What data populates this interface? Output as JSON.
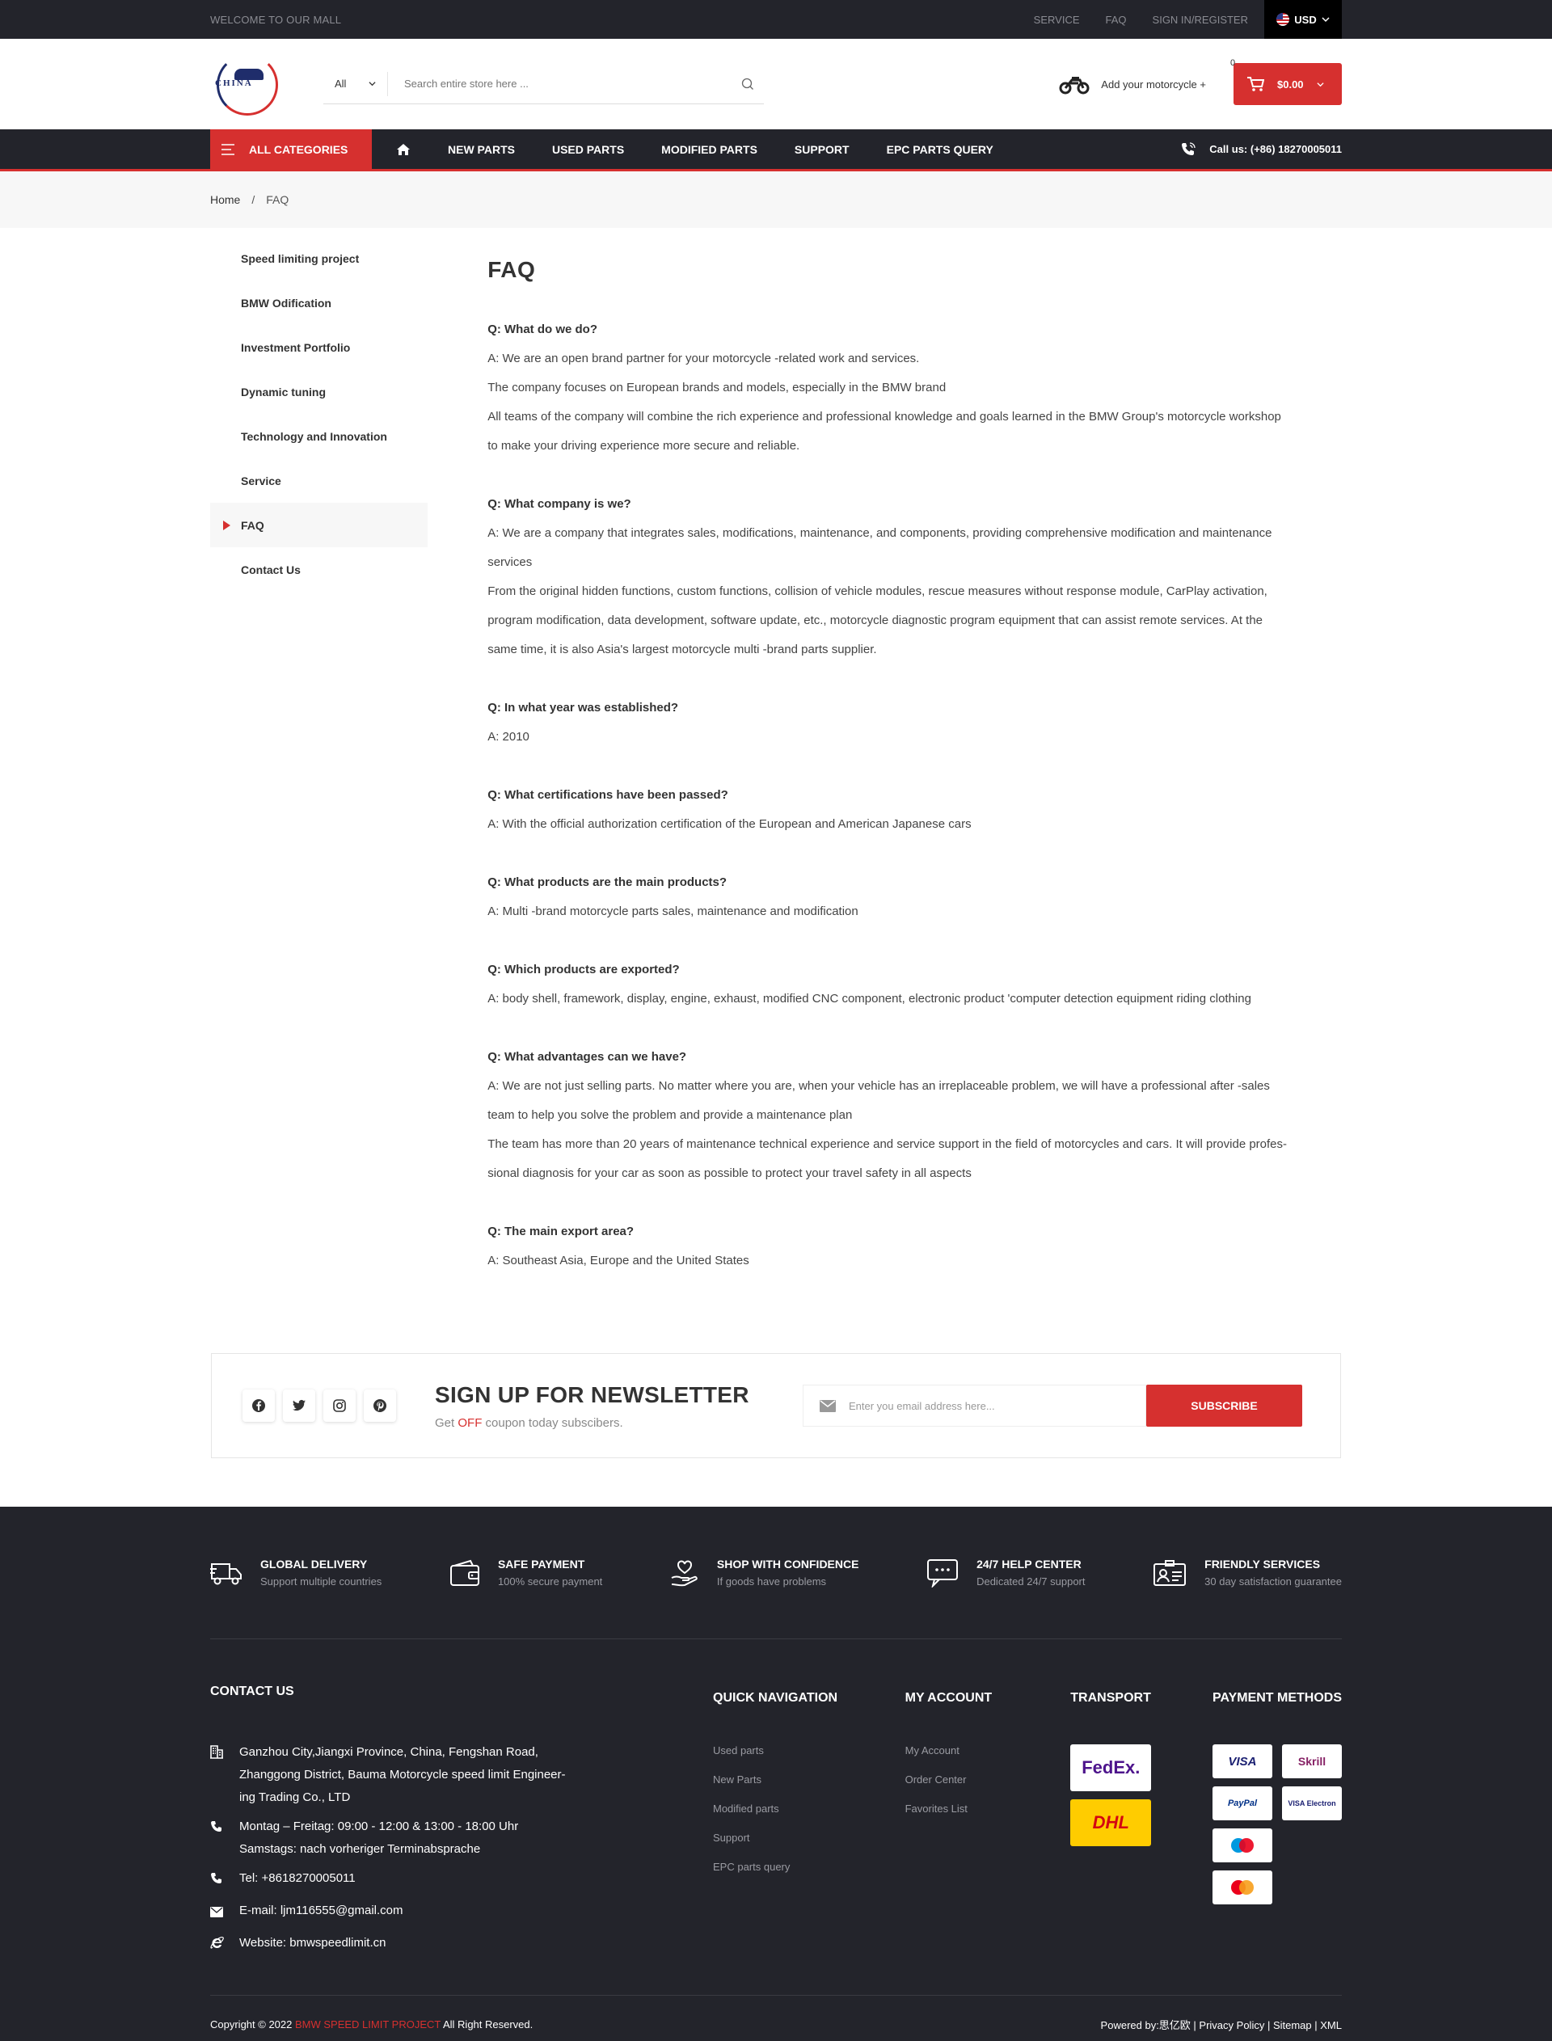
{
  "topbar": {
    "welcome": "WELCOME TO OUR MALL",
    "links": [
      "SERVICE",
      "FAQ",
      "SIGN IN/REGISTER"
    ],
    "currency": "USD"
  },
  "header": {
    "logo_text": "CHINA",
    "search_category": "All",
    "search_placeholder": "Search entire store here ...",
    "motorcycle_label": "Add your motorcycle +",
    "cart_count": "0",
    "cart_total": "$0.00"
  },
  "nav": {
    "all_categories": "ALL CATEGORIES",
    "items": [
      "NEW PARTS",
      "USED PARTS",
      "MODIFIED PARTS",
      "SUPPORT",
      "EPC PARTS QUERY"
    ],
    "call": "Call us: (+86) 18270005011"
  },
  "breadcrumb": {
    "home": "Home",
    "sep": "/",
    "current": "FAQ"
  },
  "sidebar": {
    "items": [
      "Speed limiting project",
      "BMW Odification",
      "Investment Portfolio",
      "Dynamic tuning",
      "Technology and Innovation",
      "Service",
      "FAQ",
      "Contact Us"
    ],
    "active": "FAQ"
  },
  "page_title": "FAQ",
  "faq": [
    {
      "q": "Q: What do we do?",
      "a": [
        "A: We are an open brand partner for your motorcycle -related work and services.",
        "The company focuses on European brands and models, especially in the BMW brand",
        "All teams of the company will combine the rich experience and professional knowledge and goals learned in the BMW Group's motorcycle workshop",
        "to make your driving experience more secure and reliable."
      ]
    },
    {
      "q": "Q: What company is we?",
      "a": [
        "A: We are a company that integrates sales, modifications, maintenance, and components, providing comprehensive modification and maintenance",
        "services",
        "From the original hidden functions, custom functions, collision of vehicle modules, rescue measures without response module, CarPlay activation,",
        "program modification, data development, software update, etc., motorcycle diagnostic program equipment that can assist remote services. At the",
        "same time, it is also Asia's largest motorcycle multi -brand parts supplier."
      ]
    },
    {
      "q": "Q: In what year was established?",
      "a": [
        "A: 2010"
      ]
    },
    {
      "q": "Q: What certifications have been passed?",
      "a": [
        "A: With the official authorization certification of the European and American Japanese cars"
      ]
    },
    {
      "q": "Q: What products are the main products?",
      "a": [
        "A: Multi -brand motorcycle parts sales, maintenance and modification"
      ]
    },
    {
      "q": "Q: Which products are exported?",
      "a": [
        "A: body shell, framework, display, engine, exhaust, modified CNC component, electronic product 'computer detection equipment riding clothing"
      ]
    },
    {
      "q": "Q: What advantages can we have?",
      "a": [
        "A: We are not just selling parts. No matter where you are, when your vehicle has an irreplaceable problem, we will have a professional after -sales",
        "team to help you solve the problem and provide a maintenance plan",
        "The team has more than 20 years of maintenance technical experience and service support in the field of motorcycles and cars. It will provide profes-",
        "sional diagnosis for your car as soon as possible to protect your travel safety in all aspects"
      ]
    },
    {
      "q": "Q: The main export area?",
      "a": [
        "A: Southeast Asia, Europe and the United States"
      ]
    }
  ],
  "newsletter": {
    "title": "SIGN UP FOR NEWSLETTER",
    "sub_pre": "Get ",
    "sub_off": "OFF",
    "sub_post": " coupon today subscibers.",
    "placeholder": "Enter you email address here...",
    "button": "SUBSCRIBE",
    "socials": [
      "facebook-icon",
      "twitter-icon",
      "instagram-icon",
      "pinterest-icon"
    ]
  },
  "features": [
    {
      "title": "GLOBAL DELIVERY",
      "desc": "Support multiple countries",
      "icon": "truck-icon"
    },
    {
      "title": "SAFE PAYMENT",
      "desc": "100% secure payment",
      "icon": "wallet-icon"
    },
    {
      "title": "SHOP WITH CONFIDENCE",
      "desc": "If goods have problems",
      "icon": "hand-heart-icon"
    },
    {
      "title": "24/7 HELP CENTER",
      "desc": "Dedicated 24/7 support",
      "icon": "chat-icon"
    },
    {
      "title": "FRIENDLY SERVICES",
      "desc": "30 day satisfaction guarantee",
      "icon": "id-card-icon"
    }
  ],
  "contact": {
    "title": "CONTACT US",
    "address": [
      "Ganzhou City,Jiangxi Province, China, Fengshan Road,",
      "Zhanggong District, Bauma Motorcycle speed limit Engineer-",
      "ing Trading Co., LTD"
    ],
    "hours": [
      "Montag – Freitag: 09:00 - 12:00 & 13:00 - 18:00 Uhr",
      "Samstags: nach vorheriger Terminabsprache"
    ],
    "tel": "Tel: +8618270005011",
    "email": "E-mail: ljm116555@gmail.com",
    "website": "Website: bmwspeedlimit.cn"
  },
  "quick_nav": {
    "title": "QUICK NAVIGATION",
    "links": [
      "Used parts",
      "New Parts",
      "Modified parts",
      "Support",
      "EPC parts query"
    ]
  },
  "my_account": {
    "title": "MY ACCOUNT",
    "links": [
      "My Account",
      "Order Center",
      "Favorites List"
    ]
  },
  "transport": {
    "title": "TRANSPORT",
    "fedex": "FedEx.",
    "dhl": "DHL"
  },
  "payment": {
    "title": "PAYMENT METHODS",
    "cards": [
      "VISA",
      "Skrill",
      "PayPal",
      "VISA Electron",
      "Maestro",
      "MasterCard"
    ]
  },
  "bottom": {
    "copy_pre": "Copyright © 2022 ",
    "copy_brand": "BMW SPEED LIMIT PROJECT",
    "copy_post": " All Right Reserved.",
    "right": [
      "Powered by:思亿欧",
      "Privacy Policy",
      "Sitemap",
      "XML"
    ]
  },
  "colors": {
    "accent": "#d6302f",
    "dark": "#23242b"
  }
}
